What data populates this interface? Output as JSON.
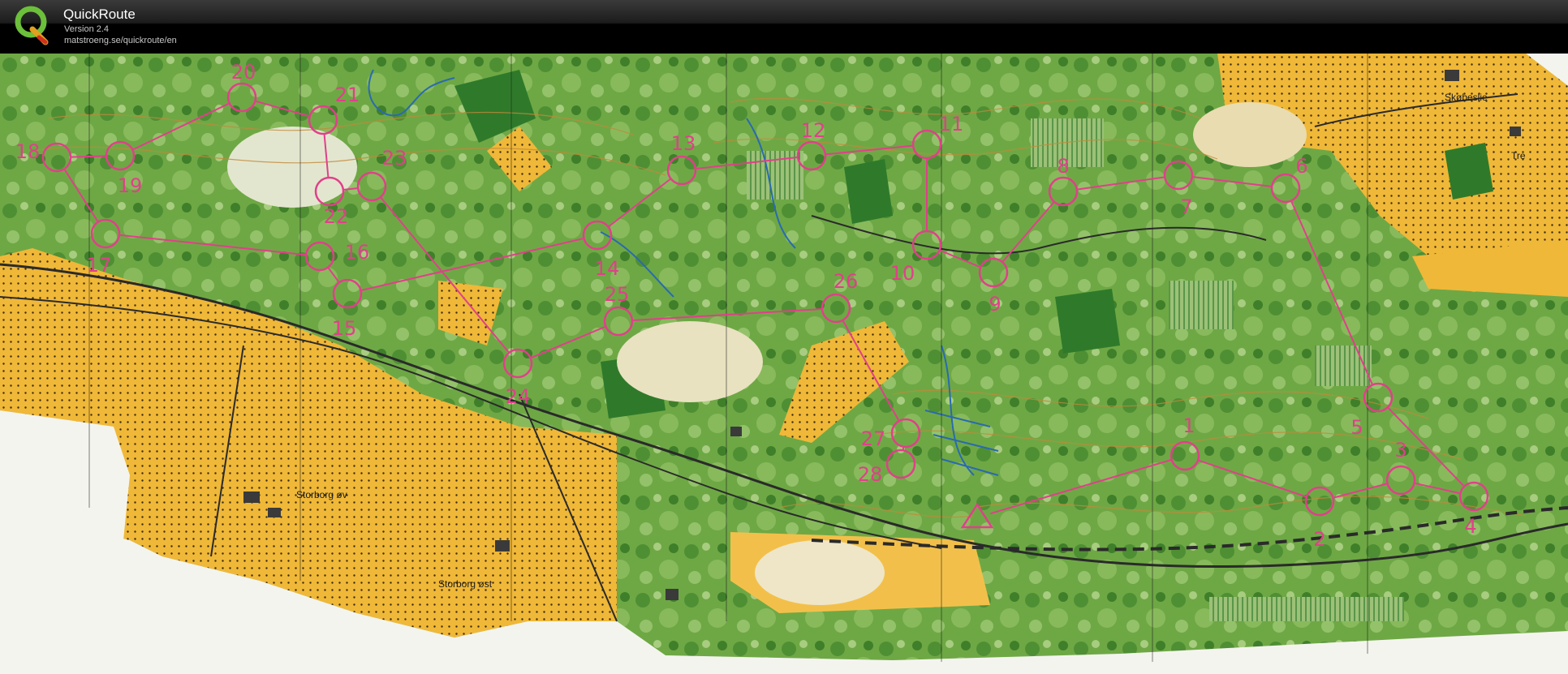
{
  "app": {
    "name": "QuickRoute",
    "version": "Version 2.4",
    "url": "matstroeng.se/quickroute/en",
    "logo_letter": "Q"
  },
  "map": {
    "type": "orienteering-map",
    "colors": {
      "forest": "#5f9a3c",
      "dark_green": "#2f7a2a",
      "light_green": "#9cc177",
      "open": "#f0b838",
      "paper": "#f4f4ee",
      "course": "#e0408a",
      "contour": "#c28a3a",
      "water": "#2a6ab0",
      "road": "#2a2a2a"
    },
    "place_names": {
      "skobeslie": "Skøbeslie",
      "tre": "Tre",
      "storborg_vest": "Storborg øv",
      "storborg_ost": "Storborg øst"
    },
    "controls": [
      {
        "id": "c1",
        "label": "1"
      },
      {
        "id": "c2",
        "label": "2"
      },
      {
        "id": "c3",
        "label": "3"
      },
      {
        "id": "c4",
        "label": "4"
      },
      {
        "id": "c5",
        "label": "5"
      },
      {
        "id": "c6",
        "label": "6"
      },
      {
        "id": "c7",
        "label": "7"
      },
      {
        "id": "c8",
        "label": "8"
      },
      {
        "id": "c9",
        "label": "9"
      },
      {
        "id": "c10",
        "label": "10"
      },
      {
        "id": "c11",
        "label": "11"
      },
      {
        "id": "c12",
        "label": "12"
      },
      {
        "id": "c13",
        "label": "13"
      },
      {
        "id": "c14",
        "label": "14"
      },
      {
        "id": "c15",
        "label": "15"
      },
      {
        "id": "c16",
        "label": "16"
      },
      {
        "id": "c17",
        "label": "17"
      },
      {
        "id": "c18",
        "label": "18"
      },
      {
        "id": "c19",
        "label": "19"
      },
      {
        "id": "c20",
        "label": "20"
      },
      {
        "id": "c21",
        "label": "21"
      },
      {
        "id": "c22",
        "label": "22"
      },
      {
        "id": "c23",
        "label": "23"
      },
      {
        "id": "c24",
        "label": "24"
      },
      {
        "id": "c25",
        "label": "25"
      },
      {
        "id": "c26",
        "label": "26"
      },
      {
        "id": "c27",
        "label": "27"
      },
      {
        "id": "c28",
        "label": "28"
      }
    ]
  }
}
